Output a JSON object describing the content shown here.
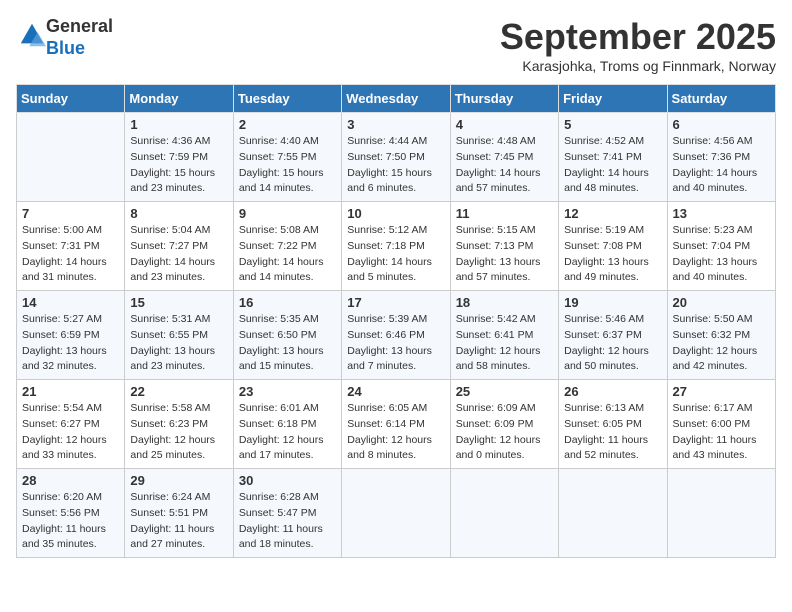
{
  "logo": {
    "general": "General",
    "blue": "Blue"
  },
  "title": "September 2025",
  "subtitle": "Karasjohka, Troms og Finnmark, Norway",
  "headers": [
    "Sunday",
    "Monday",
    "Tuesday",
    "Wednesday",
    "Thursday",
    "Friday",
    "Saturday"
  ],
  "weeks": [
    [
      {
        "num": "",
        "sunrise": "",
        "sunset": "",
        "daylight": ""
      },
      {
        "num": "1",
        "sunrise": "Sunrise: 4:36 AM",
        "sunset": "Sunset: 7:59 PM",
        "daylight": "Daylight: 15 hours and 23 minutes."
      },
      {
        "num": "2",
        "sunrise": "Sunrise: 4:40 AM",
        "sunset": "Sunset: 7:55 PM",
        "daylight": "Daylight: 15 hours and 14 minutes."
      },
      {
        "num": "3",
        "sunrise": "Sunrise: 4:44 AM",
        "sunset": "Sunset: 7:50 PM",
        "daylight": "Daylight: 15 hours and 6 minutes."
      },
      {
        "num": "4",
        "sunrise": "Sunrise: 4:48 AM",
        "sunset": "Sunset: 7:45 PM",
        "daylight": "Daylight: 14 hours and 57 minutes."
      },
      {
        "num": "5",
        "sunrise": "Sunrise: 4:52 AM",
        "sunset": "Sunset: 7:41 PM",
        "daylight": "Daylight: 14 hours and 48 minutes."
      },
      {
        "num": "6",
        "sunrise": "Sunrise: 4:56 AM",
        "sunset": "Sunset: 7:36 PM",
        "daylight": "Daylight: 14 hours and 40 minutes."
      }
    ],
    [
      {
        "num": "7",
        "sunrise": "Sunrise: 5:00 AM",
        "sunset": "Sunset: 7:31 PM",
        "daylight": "Daylight: 14 hours and 31 minutes."
      },
      {
        "num": "8",
        "sunrise": "Sunrise: 5:04 AM",
        "sunset": "Sunset: 7:27 PM",
        "daylight": "Daylight: 14 hours and 23 minutes."
      },
      {
        "num": "9",
        "sunrise": "Sunrise: 5:08 AM",
        "sunset": "Sunset: 7:22 PM",
        "daylight": "Daylight: 14 hours and 14 minutes."
      },
      {
        "num": "10",
        "sunrise": "Sunrise: 5:12 AM",
        "sunset": "Sunset: 7:18 PM",
        "daylight": "Daylight: 14 hours and 5 minutes."
      },
      {
        "num": "11",
        "sunrise": "Sunrise: 5:15 AM",
        "sunset": "Sunset: 7:13 PM",
        "daylight": "Daylight: 13 hours and 57 minutes."
      },
      {
        "num": "12",
        "sunrise": "Sunrise: 5:19 AM",
        "sunset": "Sunset: 7:08 PM",
        "daylight": "Daylight: 13 hours and 49 minutes."
      },
      {
        "num": "13",
        "sunrise": "Sunrise: 5:23 AM",
        "sunset": "Sunset: 7:04 PM",
        "daylight": "Daylight: 13 hours and 40 minutes."
      }
    ],
    [
      {
        "num": "14",
        "sunrise": "Sunrise: 5:27 AM",
        "sunset": "Sunset: 6:59 PM",
        "daylight": "Daylight: 13 hours and 32 minutes."
      },
      {
        "num": "15",
        "sunrise": "Sunrise: 5:31 AM",
        "sunset": "Sunset: 6:55 PM",
        "daylight": "Daylight: 13 hours and 23 minutes."
      },
      {
        "num": "16",
        "sunrise": "Sunrise: 5:35 AM",
        "sunset": "Sunset: 6:50 PM",
        "daylight": "Daylight: 13 hours and 15 minutes."
      },
      {
        "num": "17",
        "sunrise": "Sunrise: 5:39 AM",
        "sunset": "Sunset: 6:46 PM",
        "daylight": "Daylight: 13 hours and 7 minutes."
      },
      {
        "num": "18",
        "sunrise": "Sunrise: 5:42 AM",
        "sunset": "Sunset: 6:41 PM",
        "daylight": "Daylight: 12 hours and 58 minutes."
      },
      {
        "num": "19",
        "sunrise": "Sunrise: 5:46 AM",
        "sunset": "Sunset: 6:37 PM",
        "daylight": "Daylight: 12 hours and 50 minutes."
      },
      {
        "num": "20",
        "sunrise": "Sunrise: 5:50 AM",
        "sunset": "Sunset: 6:32 PM",
        "daylight": "Daylight: 12 hours and 42 minutes."
      }
    ],
    [
      {
        "num": "21",
        "sunrise": "Sunrise: 5:54 AM",
        "sunset": "Sunset: 6:27 PM",
        "daylight": "Daylight: 12 hours and 33 minutes."
      },
      {
        "num": "22",
        "sunrise": "Sunrise: 5:58 AM",
        "sunset": "Sunset: 6:23 PM",
        "daylight": "Daylight: 12 hours and 25 minutes."
      },
      {
        "num": "23",
        "sunrise": "Sunrise: 6:01 AM",
        "sunset": "Sunset: 6:18 PM",
        "daylight": "Daylight: 12 hours and 17 minutes."
      },
      {
        "num": "24",
        "sunrise": "Sunrise: 6:05 AM",
        "sunset": "Sunset: 6:14 PM",
        "daylight": "Daylight: 12 hours and 8 minutes."
      },
      {
        "num": "25",
        "sunrise": "Sunrise: 6:09 AM",
        "sunset": "Sunset: 6:09 PM",
        "daylight": "Daylight: 12 hours and 0 minutes."
      },
      {
        "num": "26",
        "sunrise": "Sunrise: 6:13 AM",
        "sunset": "Sunset: 6:05 PM",
        "daylight": "Daylight: 11 hours and 52 minutes."
      },
      {
        "num": "27",
        "sunrise": "Sunrise: 6:17 AM",
        "sunset": "Sunset: 6:00 PM",
        "daylight": "Daylight: 11 hours and 43 minutes."
      }
    ],
    [
      {
        "num": "28",
        "sunrise": "Sunrise: 6:20 AM",
        "sunset": "Sunset: 5:56 PM",
        "daylight": "Daylight: 11 hours and 35 minutes."
      },
      {
        "num": "29",
        "sunrise": "Sunrise: 6:24 AM",
        "sunset": "Sunset: 5:51 PM",
        "daylight": "Daylight: 11 hours and 27 minutes."
      },
      {
        "num": "30",
        "sunrise": "Sunrise: 6:28 AM",
        "sunset": "Sunset: 5:47 PM",
        "daylight": "Daylight: 11 hours and 18 minutes."
      },
      {
        "num": "",
        "sunrise": "",
        "sunset": "",
        "daylight": ""
      },
      {
        "num": "",
        "sunrise": "",
        "sunset": "",
        "daylight": ""
      },
      {
        "num": "",
        "sunrise": "",
        "sunset": "",
        "daylight": ""
      },
      {
        "num": "",
        "sunrise": "",
        "sunset": "",
        "daylight": ""
      }
    ]
  ]
}
